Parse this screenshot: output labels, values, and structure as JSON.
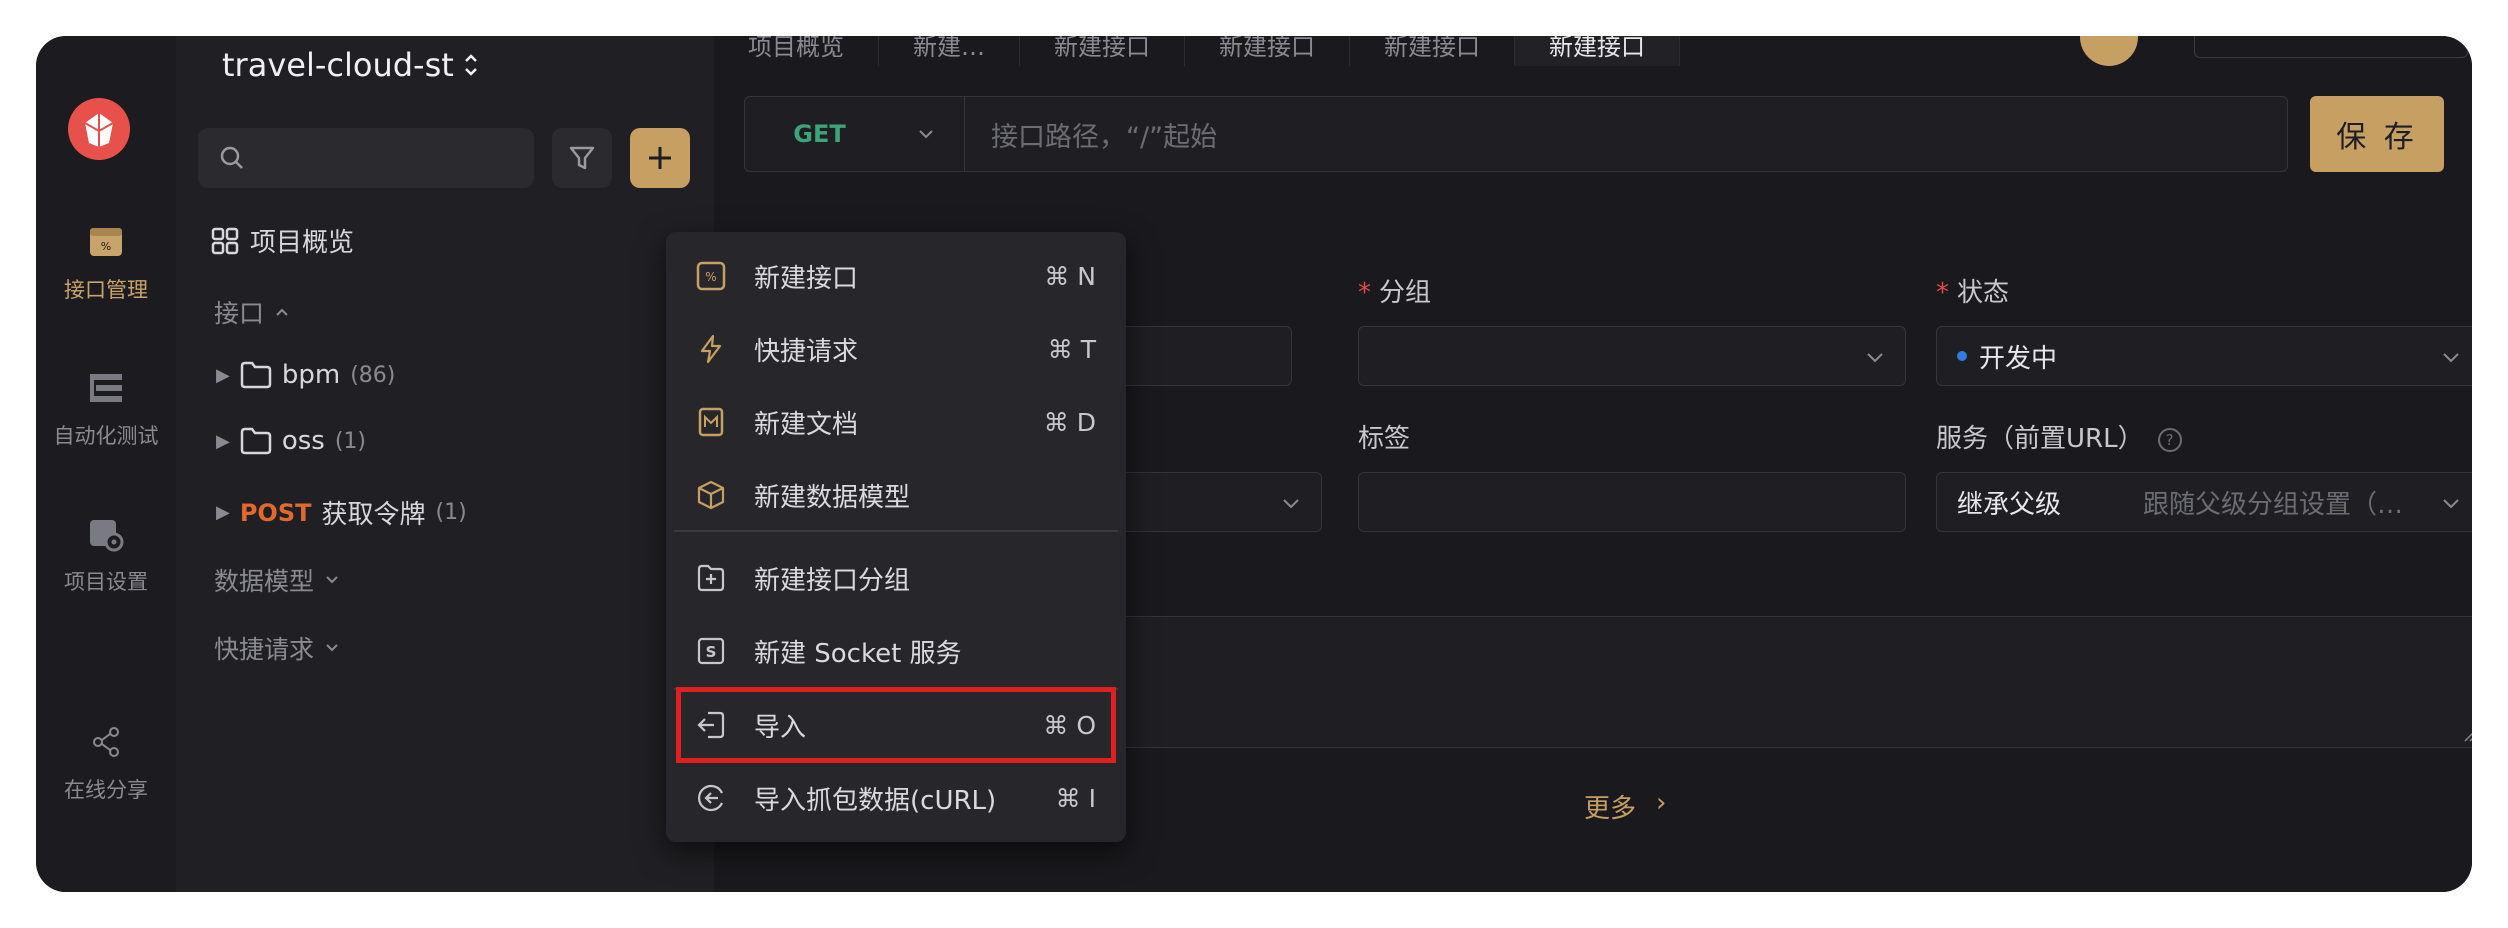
{
  "rail": {
    "items": [
      {
        "label": "接口管理",
        "icon": "api-icon",
        "active": true
      },
      {
        "label": "自动化测试",
        "icon": "automation-icon"
      },
      {
        "label": "项目设置",
        "icon": "settings-icon"
      },
      {
        "label": "在线分享",
        "icon": "share-icon"
      }
    ]
  },
  "project": {
    "name": "travel-cloud-st"
  },
  "tree": {
    "overview": "项目概览",
    "api_section": "接口",
    "folders": [
      {
        "name": "bpm",
        "count": "(86)"
      },
      {
        "name": "oss",
        "count": "(1)"
      }
    ],
    "endpoint": {
      "method": "POST",
      "name": "获取令牌",
      "count": "(1)"
    },
    "data_models": "数据模型",
    "quick_requests": "快捷请求"
  },
  "tabs": [
    "项目概览",
    "新建…",
    "新建接口",
    "新建接口",
    "新建接口",
    "新建接口"
  ],
  "url_bar": {
    "method": "GET",
    "placeholder": "接口路径，“/”起始",
    "save": "保 存"
  },
  "form": {
    "group_label": "分组",
    "status_label": "状态",
    "status_value": "开发中",
    "tags_label": "标签",
    "service_label": "服务（前置URL）",
    "service_value": "继承父级",
    "service_hint": "跟随父级分组设置（…",
    "help": "?",
    "more": "更多",
    "more_arrow": "›"
  },
  "menu": {
    "items": [
      {
        "label": "新建接口",
        "shortcut": "⌘ N",
        "icon": "new-api-icon"
      },
      {
        "label": "快捷请求",
        "shortcut": "⌘ T",
        "icon": "lightning-icon"
      },
      {
        "label": "新建文档",
        "shortcut": "⌘ D",
        "icon": "markdown-doc-icon"
      },
      {
        "label": "新建数据模型",
        "shortcut": "",
        "icon": "cube-icon"
      },
      {
        "label": "新建接口分组",
        "shortcut": "",
        "icon": "folder-plus-icon"
      },
      {
        "label": "新建 Socket 服务",
        "shortcut": "",
        "icon": "socket-icon"
      },
      {
        "label": "导入",
        "shortcut": "⌘ O",
        "icon": "import-icon",
        "highlighted": true
      },
      {
        "label": "导入抓包数据(cURL)",
        "shortcut": "⌘ I",
        "icon": "curl-import-icon"
      }
    ]
  },
  "colors": {
    "accent": "#c6a063",
    "get": "#3aa57a",
    "post": "#e06a2b",
    "status_dot": "#2f7de1",
    "highlight": "#e02020"
  }
}
